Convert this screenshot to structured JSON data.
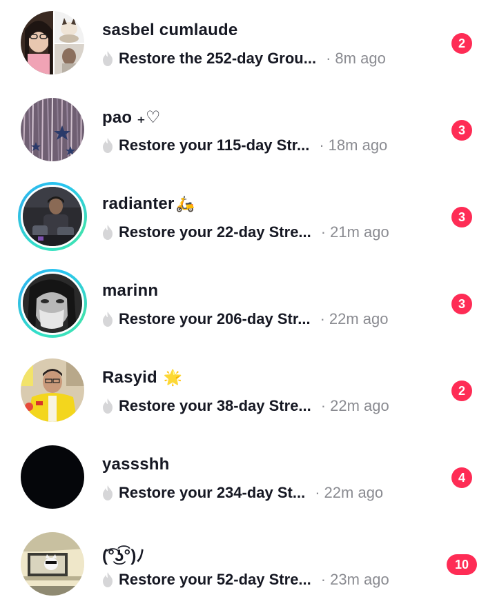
{
  "accent_badge_color": "#fe2c55",
  "chats": [
    {
      "name": "sasbel cumlaude",
      "name_emoji": "",
      "message": "Restore the 252-day Grou...",
      "time": "8m ago",
      "unread": "2",
      "avatar": "sasbel-avatar",
      "ring": false
    },
    {
      "name": "pao ₊♡",
      "name_emoji": "",
      "message": "Restore your 115-day Str...",
      "time": "18m ago",
      "unread": "3",
      "avatar": "pao-avatar",
      "ring": false
    },
    {
      "name": "radianter",
      "name_emoji": "🛵",
      "message": "Restore your 22-day Stre...",
      "time": "21m ago",
      "unread": "3",
      "avatar": "radianter-avatar",
      "ring": true
    },
    {
      "name": "marinn",
      "name_emoji": "",
      "message": "Restore your 206-day Str...",
      "time": "22m ago",
      "unread": "3",
      "avatar": "marinn-avatar",
      "ring": true
    },
    {
      "name": "Rasyid",
      "name_emoji": "🌟",
      "message": "Restore your 38-day Stre...",
      "time": "22m ago",
      "unread": "2",
      "avatar": "rasyid-avatar",
      "ring": false
    },
    {
      "name": "yassshh",
      "name_emoji": "",
      "message": "Restore your 234-day St...",
      "time": "22m ago",
      "unread": "4",
      "avatar": "yassshh-avatar",
      "ring": false
    },
    {
      "name": "(͡°͜ʖ͡°)ﾉ",
      "name_emoji": "",
      "message": "Restore your 52-day Stre...",
      "time": "23m ago",
      "unread": "10",
      "avatar": "kaomoji-avatar",
      "ring": false
    }
  ],
  "time_separator": "·"
}
